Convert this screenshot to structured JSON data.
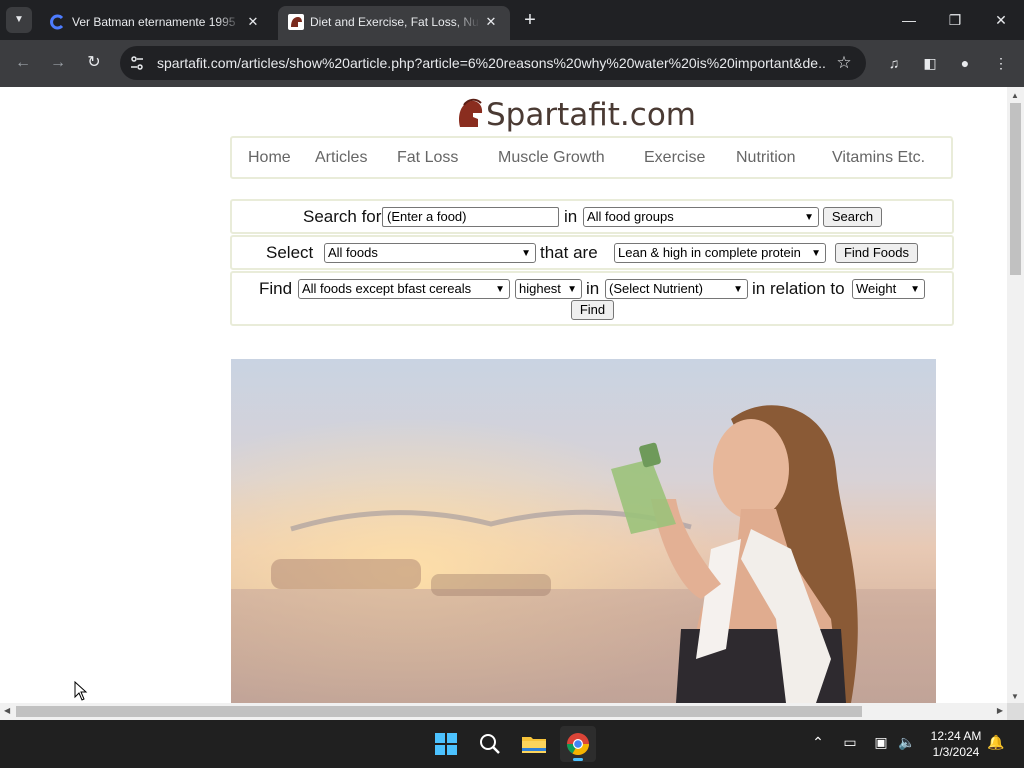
{
  "browser": {
    "tabs": [
      {
        "title": "Ver Batman eternamente 1995",
        "active": false,
        "favicon": "cuevana-c-icon"
      },
      {
        "title": "Diet and Exercise, Fat Loss, Nutrition",
        "active": true,
        "favicon": "spartafit-helmet-icon"
      }
    ],
    "new_tab_label": "+",
    "url": "spartafit.com/articles/show%20article.php?article=6%20reasons%20why%20water%20is%20important&de..."
  },
  "site": {
    "logo_text": "Spartafit.com",
    "nav": [
      "Home",
      "Articles",
      "Fat Loss",
      "Muscle Growth",
      "Exercise",
      "Nutrition",
      "Vitamins Etc."
    ]
  },
  "search_form": {
    "label_search_for": "Search for",
    "food_input_value": "(Enter a food)",
    "label_in": "in",
    "food_group_select": "All food groups",
    "search_button": "Search"
  },
  "select_form": {
    "label_select": "Select",
    "foods_select": "All foods",
    "label_that_are": "that are",
    "criteria_select": "Lean & high in complete protein",
    "find_foods_button": "Find Foods"
  },
  "find_form": {
    "label_find": "Find",
    "foods_select": "All foods except bfast cereals",
    "order_select": "highest",
    "label_in": "in",
    "nutrient_select": "(Select Nutrient)",
    "label_relation": "in relation to",
    "relation_select": "Weight",
    "find_button": "Find"
  },
  "hero_image": {
    "description_icon": "woman-drinking-water-photo"
  },
  "taskbar": {
    "time": "12:24 AM",
    "date": "1/3/2024"
  },
  "colors": {
    "chrome_dark": "#202124",
    "chrome_toolbar": "#3c3d40",
    "logo_brown": "#4a3a33",
    "box_border": "#e9ecd9",
    "nav_text": "#666666"
  }
}
